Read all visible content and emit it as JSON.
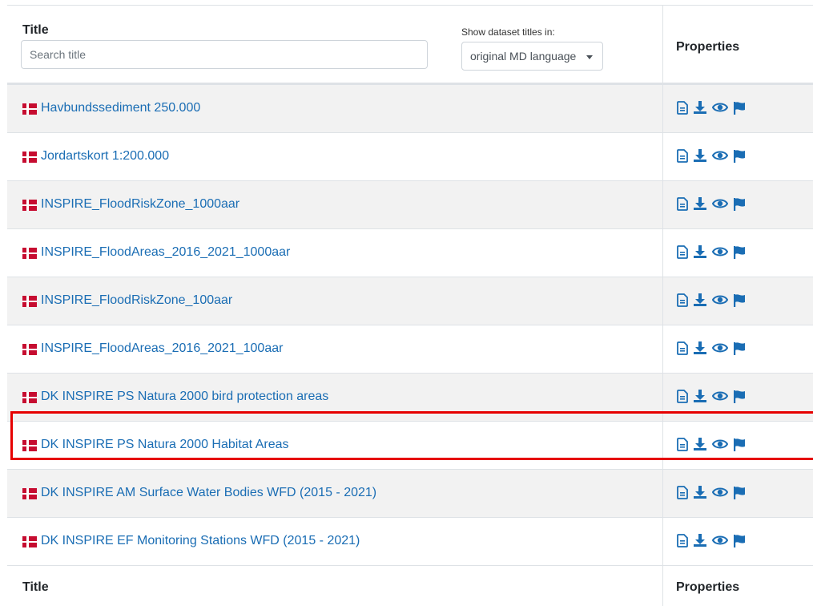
{
  "header": {
    "title_label": "Title",
    "search_placeholder": "Search title",
    "lang_label": "Show dataset titles in:",
    "lang_selected": "original MD language",
    "properties_label": "Properties"
  },
  "rows": [
    {
      "title": "Havbundssediment 250.000"
    },
    {
      "title": "Jordartskort 1:200.000"
    },
    {
      "title": "INSPIRE_FloodRiskZone_1000aar"
    },
    {
      "title": "INSPIRE_FloodAreas_2016_2021_1000aar"
    },
    {
      "title": "INSPIRE_FloodRiskZone_100aar"
    },
    {
      "title": "INSPIRE_FloodAreas_2016_2021_100aar"
    },
    {
      "title": "DK INSPIRE PS Natura 2000 bird protection areas"
    },
    {
      "title": "DK INSPIRE PS Natura 2000 Habitat Areas"
    },
    {
      "title": "DK INSPIRE AM Surface Water Bodies WFD (2015 - 2021)"
    },
    {
      "title": "DK INSPIRE EF Monitoring Stations WFD (2015 - 2021)"
    }
  ],
  "footer": {
    "title_label": "Title",
    "properties_label": "Properties"
  },
  "icons": [
    "document-icon",
    "download-icon",
    "eye-icon",
    "flag-icon"
  ],
  "colors": {
    "link": "#1a6db4",
    "icon": "#1a6db4",
    "danish_flag_red": "#c60c30",
    "highlight": "#e60000"
  }
}
